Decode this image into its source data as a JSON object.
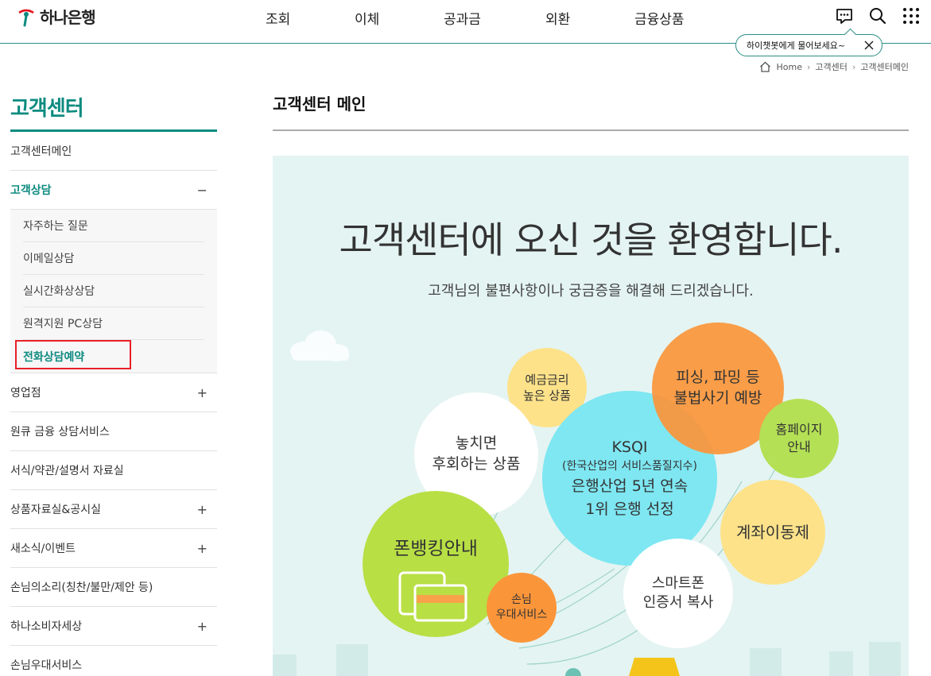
{
  "brand": {
    "name": "하나은행"
  },
  "gnb": [
    "조회",
    "이체",
    "공과금",
    "외환",
    "금융상품"
  ],
  "chat_tip": {
    "text": "하이챗봇에게 물어보세요~"
  },
  "breadcrumb": [
    "Home",
    "고객센터",
    "고객센터메인"
  ],
  "lnb": {
    "title": "고객센터",
    "items": [
      {
        "label": "고객센터메인",
        "sign": ""
      },
      {
        "label": "고객상담",
        "sign": "−"
      },
      {
        "label": "영업점",
        "sign": "+"
      },
      {
        "label": "원큐 금융 상담서비스",
        "sign": ""
      },
      {
        "label": "서식/약관/설명서 자료실",
        "sign": ""
      },
      {
        "label": "상품자료실&공시실",
        "sign": "+"
      },
      {
        "label": "새소식/이벤트",
        "sign": "+"
      },
      {
        "label": "손님의소리(칭찬/불만/제안 등)",
        "sign": ""
      },
      {
        "label": "하나소비자세상",
        "sign": "+"
      },
      {
        "label": "손님우대서비스",
        "sign": ""
      }
    ],
    "sub_items": [
      "자주하는 질문",
      "이메일상담",
      "실시간화상상담",
      "원격지원 PC상담",
      "전화상담예약"
    ]
  },
  "main": {
    "title": "고객센터 메인",
    "banner": {
      "headline": "고객센터에 오신 것을 환영합니다.",
      "subline": "고객님의 불편사항이나 궁금증을 해결해 드리겠습니다.",
      "bubbles": {
        "deposit": [
          "예금금리",
          "높은 상품"
        ],
        "phishing": [
          "피싱, 파밍 등",
          "불법사기 예방"
        ],
        "missed": [
          "놓치면",
          "후회하는 상품"
        ],
        "ksqi": [
          "KSQI",
          "(한국산업의 서비스품질지수)",
          "은행산업 5년 연속",
          "1위 은행 선정"
        ],
        "homepage": [
          "홈페이지",
          "안내"
        ],
        "transfer": [
          "계좌이동제"
        ],
        "phonebanking": [
          "폰뱅킹안내"
        ],
        "vip": [
          "손님",
          "우대서비스"
        ],
        "smartphone": [
          "스마트폰",
          "인증서 복사"
        ]
      }
    }
  },
  "colors": {
    "accent": "#0d8b80",
    "highlight_box": "#e8202a"
  }
}
